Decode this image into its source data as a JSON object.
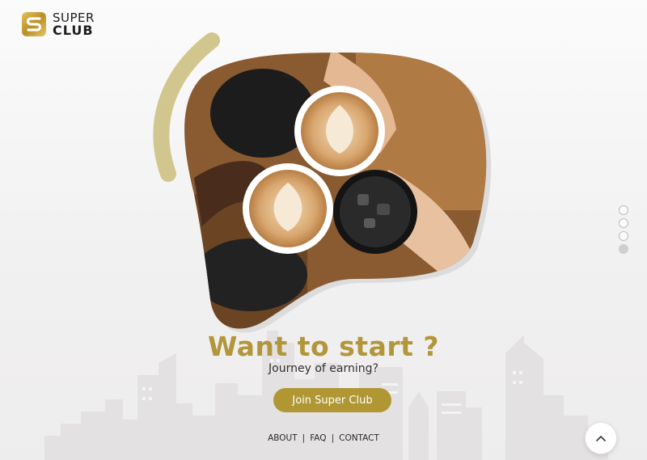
{
  "brand": {
    "line1": "SUPER",
    "line2": "CLUB",
    "logo_icon": "s-monogram-icon",
    "accent_color": "#b2963a"
  },
  "hero": {
    "image_icon": "coffee-cheers-photo"
  },
  "slider": {
    "count": 4,
    "active_index": 3
  },
  "headline": "Want to start ?",
  "subheadline": "Journey of earning?",
  "cta": {
    "label": "Join Super Club",
    "color": "#b09733"
  },
  "footer_nav": [
    {
      "label": "ABOUT"
    },
    {
      "label": "FAQ"
    },
    {
      "label": "CONTACT"
    }
  ],
  "scroll_top": {
    "icon": "chevron-up-icon"
  }
}
